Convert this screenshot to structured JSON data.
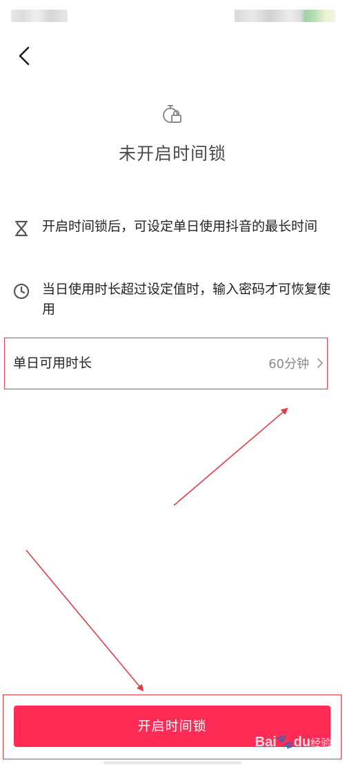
{
  "header": {
    "title": "未开启时间锁"
  },
  "info": [
    {
      "icon": "hourglass-icon",
      "text": "开启时间锁后，可设定单日使用抖音的最长时间"
    },
    {
      "icon": "clock-icon",
      "text": "当日使用时长超过设定值时，输入密码才可恢复使用"
    }
  ],
  "setting": {
    "label": "单日可用时长",
    "value": "60分钟"
  },
  "action": {
    "button_label": "开启时间锁"
  },
  "watermark": {
    "brand": "Bai",
    "suffix": "du",
    "cn": "经验"
  },
  "colors": {
    "primary": "#fe2c55",
    "highlight_box": "#e53b47",
    "annotation_arrow": "#e53b47"
  }
}
